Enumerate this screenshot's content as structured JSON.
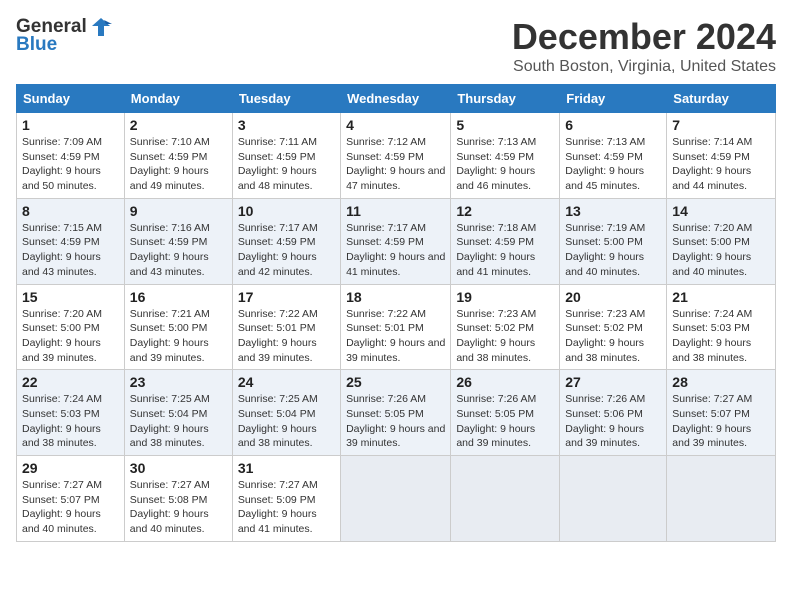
{
  "header": {
    "logo_general": "General",
    "logo_blue": "Blue",
    "month_title": "December 2024",
    "location": "South Boston, Virginia, United States"
  },
  "days_of_week": [
    "Sunday",
    "Monday",
    "Tuesday",
    "Wednesday",
    "Thursday",
    "Friday",
    "Saturday"
  ],
  "weeks": [
    [
      {
        "day": "1",
        "sunrise": "Sunrise: 7:09 AM",
        "sunset": "Sunset: 4:59 PM",
        "daylight": "Daylight: 9 hours and 50 minutes."
      },
      {
        "day": "2",
        "sunrise": "Sunrise: 7:10 AM",
        "sunset": "Sunset: 4:59 PM",
        "daylight": "Daylight: 9 hours and 49 minutes."
      },
      {
        "day": "3",
        "sunrise": "Sunrise: 7:11 AM",
        "sunset": "Sunset: 4:59 PM",
        "daylight": "Daylight: 9 hours and 48 minutes."
      },
      {
        "day": "4",
        "sunrise": "Sunrise: 7:12 AM",
        "sunset": "Sunset: 4:59 PM",
        "daylight": "Daylight: 9 hours and 47 minutes."
      },
      {
        "day": "5",
        "sunrise": "Sunrise: 7:13 AM",
        "sunset": "Sunset: 4:59 PM",
        "daylight": "Daylight: 9 hours and 46 minutes."
      },
      {
        "day": "6",
        "sunrise": "Sunrise: 7:13 AM",
        "sunset": "Sunset: 4:59 PM",
        "daylight": "Daylight: 9 hours and 45 minutes."
      },
      {
        "day": "7",
        "sunrise": "Sunrise: 7:14 AM",
        "sunset": "Sunset: 4:59 PM",
        "daylight": "Daylight: 9 hours and 44 minutes."
      }
    ],
    [
      {
        "day": "8",
        "sunrise": "Sunrise: 7:15 AM",
        "sunset": "Sunset: 4:59 PM",
        "daylight": "Daylight: 9 hours and 43 minutes."
      },
      {
        "day": "9",
        "sunrise": "Sunrise: 7:16 AM",
        "sunset": "Sunset: 4:59 PM",
        "daylight": "Daylight: 9 hours and 43 minutes."
      },
      {
        "day": "10",
        "sunrise": "Sunrise: 7:17 AM",
        "sunset": "Sunset: 4:59 PM",
        "daylight": "Daylight: 9 hours and 42 minutes."
      },
      {
        "day": "11",
        "sunrise": "Sunrise: 7:17 AM",
        "sunset": "Sunset: 4:59 PM",
        "daylight": "Daylight: 9 hours and 41 minutes."
      },
      {
        "day": "12",
        "sunrise": "Sunrise: 7:18 AM",
        "sunset": "Sunset: 4:59 PM",
        "daylight": "Daylight: 9 hours and 41 minutes."
      },
      {
        "day": "13",
        "sunrise": "Sunrise: 7:19 AM",
        "sunset": "Sunset: 5:00 PM",
        "daylight": "Daylight: 9 hours and 40 minutes."
      },
      {
        "day": "14",
        "sunrise": "Sunrise: 7:20 AM",
        "sunset": "Sunset: 5:00 PM",
        "daylight": "Daylight: 9 hours and 40 minutes."
      }
    ],
    [
      {
        "day": "15",
        "sunrise": "Sunrise: 7:20 AM",
        "sunset": "Sunset: 5:00 PM",
        "daylight": "Daylight: 9 hours and 39 minutes."
      },
      {
        "day": "16",
        "sunrise": "Sunrise: 7:21 AM",
        "sunset": "Sunset: 5:00 PM",
        "daylight": "Daylight: 9 hours and 39 minutes."
      },
      {
        "day": "17",
        "sunrise": "Sunrise: 7:22 AM",
        "sunset": "Sunset: 5:01 PM",
        "daylight": "Daylight: 9 hours and 39 minutes."
      },
      {
        "day": "18",
        "sunrise": "Sunrise: 7:22 AM",
        "sunset": "Sunset: 5:01 PM",
        "daylight": "Daylight: 9 hours and 39 minutes."
      },
      {
        "day": "19",
        "sunrise": "Sunrise: 7:23 AM",
        "sunset": "Sunset: 5:02 PM",
        "daylight": "Daylight: 9 hours and 38 minutes."
      },
      {
        "day": "20",
        "sunrise": "Sunrise: 7:23 AM",
        "sunset": "Sunset: 5:02 PM",
        "daylight": "Daylight: 9 hours and 38 minutes."
      },
      {
        "day": "21",
        "sunrise": "Sunrise: 7:24 AM",
        "sunset": "Sunset: 5:03 PM",
        "daylight": "Daylight: 9 hours and 38 minutes."
      }
    ],
    [
      {
        "day": "22",
        "sunrise": "Sunrise: 7:24 AM",
        "sunset": "Sunset: 5:03 PM",
        "daylight": "Daylight: 9 hours and 38 minutes."
      },
      {
        "day": "23",
        "sunrise": "Sunrise: 7:25 AM",
        "sunset": "Sunset: 5:04 PM",
        "daylight": "Daylight: 9 hours and 38 minutes."
      },
      {
        "day": "24",
        "sunrise": "Sunrise: 7:25 AM",
        "sunset": "Sunset: 5:04 PM",
        "daylight": "Daylight: 9 hours and 38 minutes."
      },
      {
        "day": "25",
        "sunrise": "Sunrise: 7:26 AM",
        "sunset": "Sunset: 5:05 PM",
        "daylight": "Daylight: 9 hours and 39 minutes."
      },
      {
        "day": "26",
        "sunrise": "Sunrise: 7:26 AM",
        "sunset": "Sunset: 5:05 PM",
        "daylight": "Daylight: 9 hours and 39 minutes."
      },
      {
        "day": "27",
        "sunrise": "Sunrise: 7:26 AM",
        "sunset": "Sunset: 5:06 PM",
        "daylight": "Daylight: 9 hours and 39 minutes."
      },
      {
        "day": "28",
        "sunrise": "Sunrise: 7:27 AM",
        "sunset": "Sunset: 5:07 PM",
        "daylight": "Daylight: 9 hours and 39 minutes."
      }
    ],
    [
      {
        "day": "29",
        "sunrise": "Sunrise: 7:27 AM",
        "sunset": "Sunset: 5:07 PM",
        "daylight": "Daylight: 9 hours and 40 minutes."
      },
      {
        "day": "30",
        "sunrise": "Sunrise: 7:27 AM",
        "sunset": "Sunset: 5:08 PM",
        "daylight": "Daylight: 9 hours and 40 minutes."
      },
      {
        "day": "31",
        "sunrise": "Sunrise: 7:27 AM",
        "sunset": "Sunset: 5:09 PM",
        "daylight": "Daylight: 9 hours and 41 minutes."
      },
      null,
      null,
      null,
      null
    ]
  ]
}
